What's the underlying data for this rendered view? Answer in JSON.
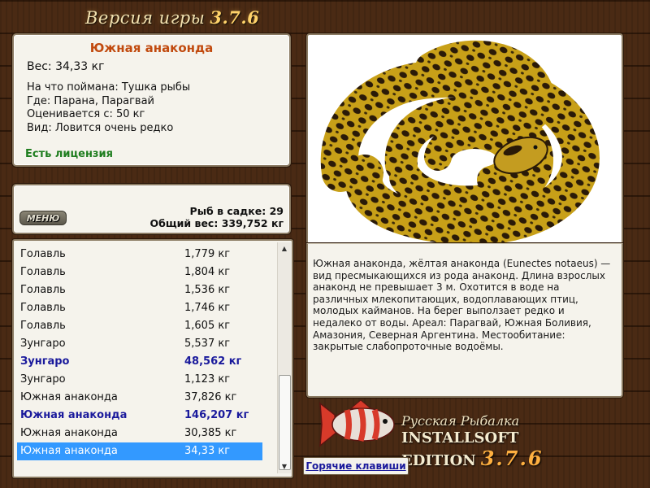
{
  "window": {
    "version_title": "Версия игры",
    "version_number": "3.7.6"
  },
  "info": {
    "name": "Южная анаконда",
    "weight_label": "Вес:",
    "weight_value": "34,33 кг",
    "bait_line": "На что поймана: Тушка рыбы",
    "location_line": "Где: Парана, Парагвай",
    "min_weight_line": "Оценивается с: 50 кг",
    "rarity_line": "Вид: Ловится очень редко",
    "license": "Есть лицензия"
  },
  "stats": {
    "menu_label": "МЕНЮ",
    "fish_count": "Рыб в садке: 29",
    "total_weight": "Общий вес: 339,752 кг"
  },
  "catch_list": [
    {
      "name": "Голавль",
      "weight": "1,779 кг",
      "highlight": false,
      "selected": false
    },
    {
      "name": "Голавль",
      "weight": "1,804 кг",
      "highlight": false,
      "selected": false
    },
    {
      "name": "Голавль",
      "weight": "1,536 кг",
      "highlight": false,
      "selected": false
    },
    {
      "name": "Голавль",
      "weight": "1,746 кг",
      "highlight": false,
      "selected": false
    },
    {
      "name": "Голавль",
      "weight": "1,605 кг",
      "highlight": false,
      "selected": false
    },
    {
      "name": "Зунгаро",
      "weight": "5,537 кг",
      "highlight": false,
      "selected": false
    },
    {
      "name": "Зунгаро",
      "weight": "48,562 кг",
      "highlight": true,
      "selected": false
    },
    {
      "name": "Зунгаро",
      "weight": "1,123 кг",
      "highlight": false,
      "selected": false
    },
    {
      "name": "Южная анаконда",
      "weight": "37,826 кг",
      "highlight": false,
      "selected": false
    },
    {
      "name": "Южная анаконда",
      "weight": "146,207 кг",
      "highlight": true,
      "selected": false
    },
    {
      "name": "Южная анаконда",
      "weight": "30,385 кг",
      "highlight": false,
      "selected": false
    },
    {
      "name": "Южная анаконда",
      "weight": "34,33 кг",
      "highlight": false,
      "selected": true
    }
  ],
  "description": "Южная анаконда, жёлтая анаконда (Eunectes notaeus) — вид пресмыкающихся из рода анаконд. Длина взрослых анаконд не превышает 3 м. Охотится в воде на различных млекопитающих, водоплавающих птиц, молодых кайманов. На берег выползает редко и недалеко от воды. Ареал: Парагвай, Южная Боливия, Амазония, Северная Аргентина. Местообитание: закрытые слабопроточные водоёмы.",
  "branding": {
    "line1": "Русская Рыбалка",
    "line2": "INSTALLSOFT EDITION",
    "version": "3.7.6"
  },
  "hotkeys_label": "Горячие клавиши",
  "colors": {
    "fish_name": "#c14a0e",
    "license": "#1e7d1e",
    "highlight_row": "#1a1a9c",
    "selected_row": "#3399ff"
  }
}
